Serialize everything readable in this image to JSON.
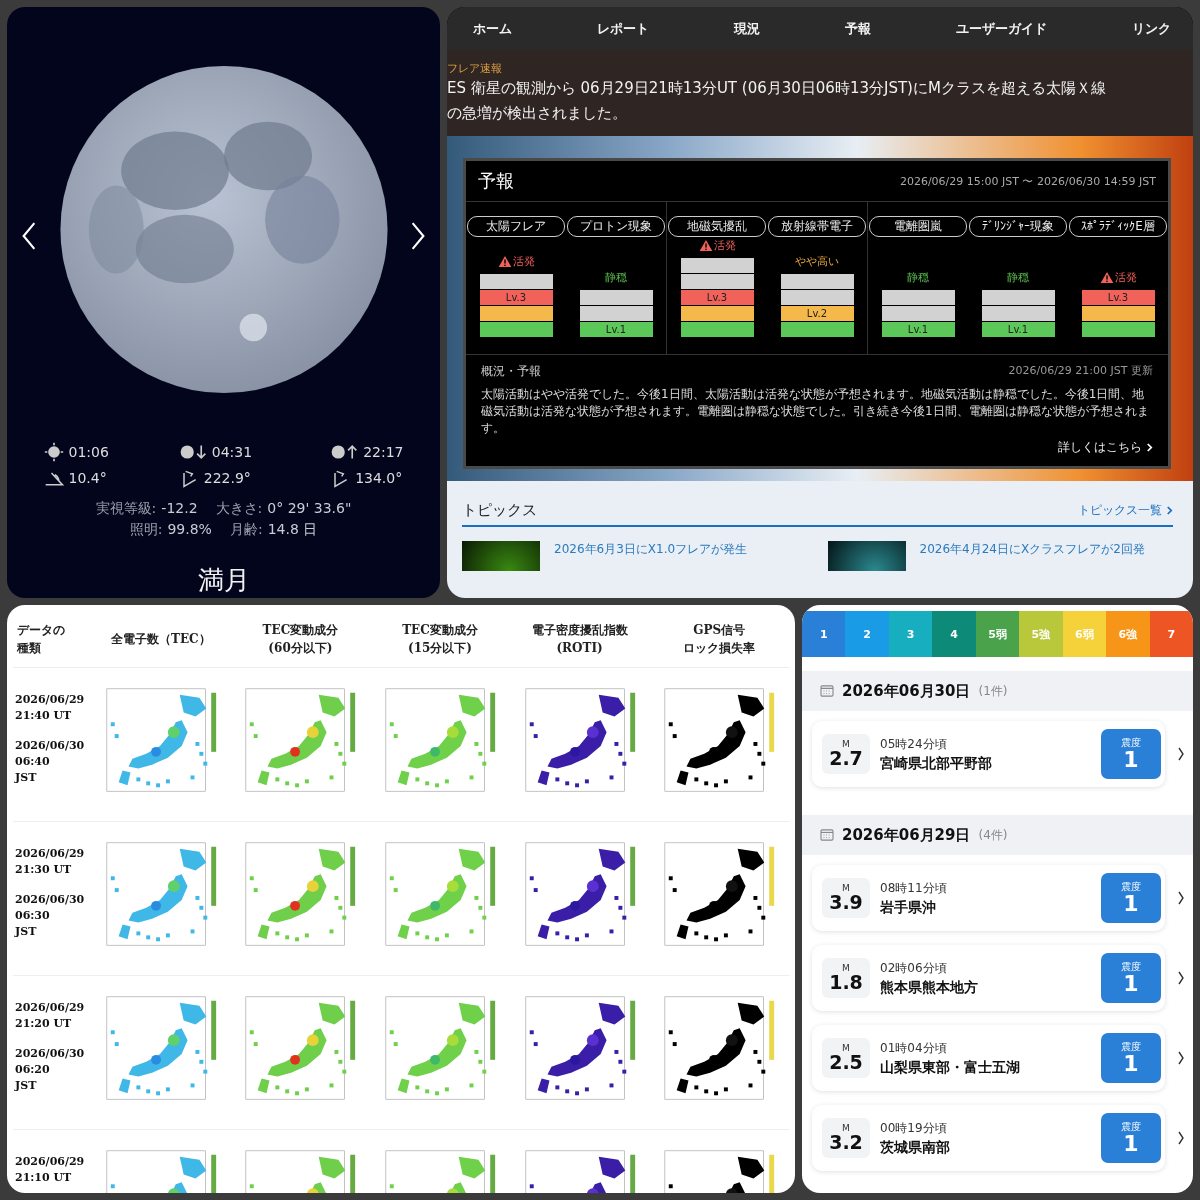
{
  "moon": {
    "events": [
      {
        "kind": "transit",
        "time": "01:06",
        "angle": "10.4°"
      },
      {
        "kind": "set",
        "time": "04:31",
        "angle": "222.9°"
      },
      {
        "kind": "rise",
        "time": "22:17",
        "angle": "134.0°"
      }
    ],
    "stats": [
      [
        {
          "label": "実視等級:",
          "value": "-12.2"
        },
        {
          "label": "大きさ:",
          "value": "0° 29' 33.6\""
        }
      ],
      [
        {
          "label": "照明:",
          "value": "99.8%"
        },
        {
          "label": "月齢:",
          "value": "14.8 日"
        }
      ]
    ],
    "phase": "満月"
  },
  "space_weather": {
    "nav": [
      {
        "label": "ホーム",
        "selected": false
      },
      {
        "label": "レポート",
        "selected": false
      },
      {
        "label": "現況",
        "selected": false
      },
      {
        "label": "予報",
        "selected": false
      },
      {
        "label": "ユーザーガイド",
        "selected": false
      },
      {
        "label": "リンク",
        "selected": false
      }
    ],
    "alert": {
      "label": "フレア速報",
      "lines": [
        "ES 衛星の観測から 06月29日21時13分UT (06月30日06時13分JST)にMクラスを超える太陽Ｘ線",
        "の急増が検出されました。"
      ]
    },
    "forecast": {
      "title": "予報",
      "period": "2026/06/29 15:00 JST 〜 2026/06/30 14:59 JST",
      "groups": [
        [
          {
            "name": "太陽フレア",
            "status": {
              "kind": "alert",
              "text": "活発"
            },
            "bars": [
              {
                "lit": false
              },
              {
                "lit": true,
                "label": "Lv.3"
              },
              {
                "lit": true
              },
              {
                "lit": true
              }
            ]
          },
          {
            "name": "プロトン現象",
            "status": {
              "kind": "quiet",
              "text": "静穏"
            },
            "bars": [
              {
                "lit": false
              },
              {
                "lit": false
              },
              {
                "lit": true,
                "label": "Lv.1"
              }
            ]
          }
        ],
        [
          {
            "name": "地磁気擾乱",
            "status": {
              "kind": "alert",
              "text": "活発"
            },
            "bars": [
              {
                "lit": false
              },
              {
                "lit": false
              },
              {
                "lit": true,
                "label": "Lv.3"
              },
              {
                "lit": true
              },
              {
                "lit": true
              }
            ]
          },
          {
            "name": "放射線帯電子",
            "status": {
              "kind": "caution",
              "text": "やや高い"
            },
            "bars": [
              {
                "lit": false
              },
              {
                "lit": false
              },
              {
                "lit": true,
                "label": "Lv.2"
              },
              {
                "lit": true
              }
            ]
          }
        ],
        [
          {
            "name": "電離圏嵐",
            "status": {
              "kind": "quiet",
              "text": "静穏"
            },
            "bars": [
              {
                "lit": false
              },
              {
                "lit": false
              },
              {
                "lit": true,
                "label": "Lv.1"
              }
            ]
          },
          {
            "name": "ﾃﾞﾘﾝｼﾞｬｰ現象",
            "status": {
              "kind": "quiet",
              "text": "静穏"
            },
            "bars": [
              {
                "lit": false
              },
              {
                "lit": false
              },
              {
                "lit": true,
                "label": "Lv.1"
              }
            ]
          },
          {
            "name": "ｽﾎﾟﾗﾃﾞｨｯｸE層",
            "status": {
              "kind": "alert",
              "text": "活発"
            },
            "bars": [
              {
                "lit": true,
                "label": "Lv.3"
              },
              {
                "lit": true
              },
              {
                "lit": true
              }
            ]
          }
        ]
      ],
      "summary": {
        "heading": "概況・予報",
        "updated": "2026/06/29 21:00 JST 更新",
        "text": "太陽活動はやや活発でした。今後1日間、太陽活動は活発な状態が予想されます。地磁気活動は静穏でした。今後1日間、地磁気活動は活発な状態が予想されます。電離圏は静穏な状態でした。引き続き今後1日間、電離圏は静穏な状態が予想されます。",
        "link": "詳しくはこちら"
      }
    },
    "topics": {
      "title": "トピックス",
      "link": "トピックス一覧",
      "items": [
        {
          "kind": "green",
          "title": "2026年6月3日にX1.0フレアが発生"
        },
        {
          "kind": "teal",
          "title": "2026年4月24日にXクラスフレアが2回発"
        }
      ]
    }
  },
  "tec_table": {
    "columns": [
      {
        "kind": "label",
        "title": [
          "データの",
          "種類"
        ]
      },
      {
        "kind": "tec",
        "title": [
          "全電子数（TEC）"
        ]
      },
      {
        "kind": "dtec60",
        "title": [
          "TEC変動成分",
          "(60分以下)"
        ]
      },
      {
        "kind": "dtec15",
        "title": [
          "TEC変動成分",
          "(15分以下)"
        ]
      },
      {
        "kind": "roti",
        "title": [
          "電子密度擾乱指数",
          "(ROTI)"
        ]
      },
      {
        "kind": "lol",
        "title": [
          "GPS信号",
          "ロック損失率"
        ]
      }
    ],
    "rows": [
      {
        "ut": "2026/06/29\n21:40 UT",
        "jst": "2026/06/30\n06:40\nJST"
      },
      {
        "ut": "2026/06/29\n21:30 UT",
        "jst": "2026/06/30\n06:30\nJST"
      },
      {
        "ut": "2026/06/29\n21:20 UT",
        "jst": "2026/06/30\n06:20\nJST"
      },
      {
        "ut": "2026/06/29\n21:10 UT"
      }
    ]
  },
  "quakes": {
    "scale": [
      {
        "label": "1",
        "color": "#2a7fd6"
      },
      {
        "label": "2",
        "color": "#1a9be6"
      },
      {
        "label": "3",
        "color": "#17aebf"
      },
      {
        "label": "4",
        "color": "#0e8a78"
      },
      {
        "label": "5弱",
        "color": "#4aa34a"
      },
      {
        "label": "5強",
        "color": "#b8c83a"
      },
      {
        "label": "6弱",
        "color": "#f6d23a"
      },
      {
        "label": "6強",
        "color": "#f79518"
      },
      {
        "label": "7",
        "color": "#ee5524"
      }
    ],
    "days": [
      {
        "date": "2026年06月30日",
        "count": "(1件)",
        "items": [
          {
            "unit": "M",
            "mag": "2.7",
            "time": "05時24分頃",
            "place": "宮崎県北部平野部",
            "intensity_label": "震度",
            "intensity": "1",
            "color": "#2a7fd6"
          }
        ]
      },
      {
        "date": "2026年06月29日",
        "count": "(4件)",
        "items": [
          {
            "unit": "M",
            "mag": "3.9",
            "time": "08時11分頃",
            "place": "岩手県沖",
            "intensity_label": "震度",
            "intensity": "1",
            "color": "#2a7fd6"
          },
          {
            "unit": "M",
            "mag": "1.8",
            "time": "02時06分頃",
            "place": "熊本県熊本地方",
            "intensity_label": "震度",
            "intensity": "1",
            "color": "#2a7fd6"
          },
          {
            "unit": "M",
            "mag": "2.5",
            "time": "01時04分頃",
            "place": "山梨県東部・富士五湖",
            "intensity_label": "震度",
            "intensity": "1",
            "color": "#2a7fd6"
          },
          {
            "unit": "M",
            "mag": "3.2",
            "time": "00時19分頃",
            "place": "茨城県南部",
            "intensity_label": "震度",
            "intensity": "1",
            "color": "#2a7fd6"
          }
        ]
      }
    ]
  }
}
